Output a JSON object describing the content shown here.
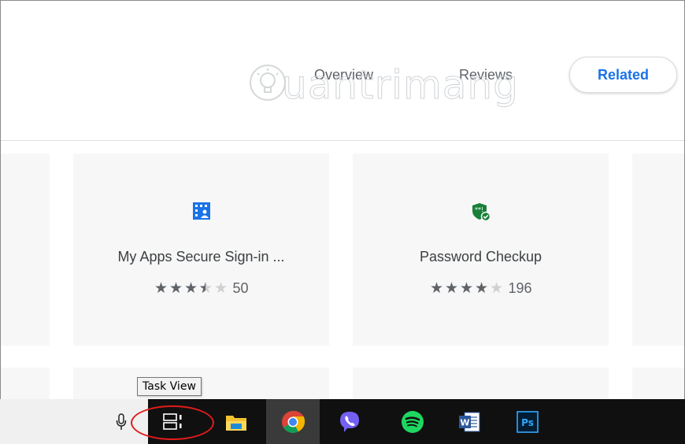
{
  "tabs": {
    "overview": "Overview",
    "reviews": "Reviews",
    "related": "Related"
  },
  "watermark": "uantrimang",
  "cards": [
    {
      "title": "My Apps Secure Sign-in ...",
      "rating": 3.5,
      "count": "50",
      "icon": "apps-grid-person-icon",
      "icon_color": "#1a73e8"
    },
    {
      "title": "Password Checkup",
      "rating": 4.5,
      "count": "196",
      "icon": "shield-check-icon",
      "icon_color": "#188038"
    }
  ],
  "tooltip": "Task View",
  "taskbar": {
    "items": [
      "microphone-icon",
      "task-view-icon",
      "file-explorer-icon",
      "chrome-icon",
      "viber-icon",
      "spotify-icon",
      "word-icon",
      "photoshop-icon"
    ],
    "ps_label": "Ps",
    "word_label": "W"
  },
  "colors": {
    "accent": "#1a73e8",
    "highlight_ring": "#e01b1b"
  }
}
